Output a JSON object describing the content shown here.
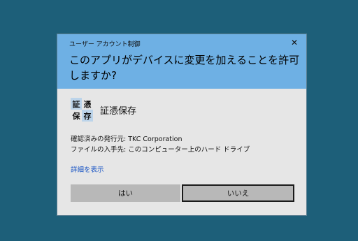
{
  "dialog": {
    "caption": "ユーザー アカウント制御",
    "close_glyph": "✕",
    "question": "このアプリがデバイスに変更を加えることを許可しますか?",
    "app": {
      "icon_chars": [
        "証",
        "憑",
        "保",
        "存"
      ],
      "name": "証憑保存"
    },
    "publisher": "確認済みの発行元: TKC Corporation",
    "origin": "ファイルの入手先: このコンピューター上のハード ドライブ",
    "details_link": "詳細を表示",
    "yes_label": "はい",
    "no_label": "いいえ"
  },
  "colors": {
    "desktop": "#1d5f79",
    "header": "#6eb0e4",
    "body": "#e6e6e6",
    "link": "#1a55c4",
    "button": "#b8b8b8"
  }
}
